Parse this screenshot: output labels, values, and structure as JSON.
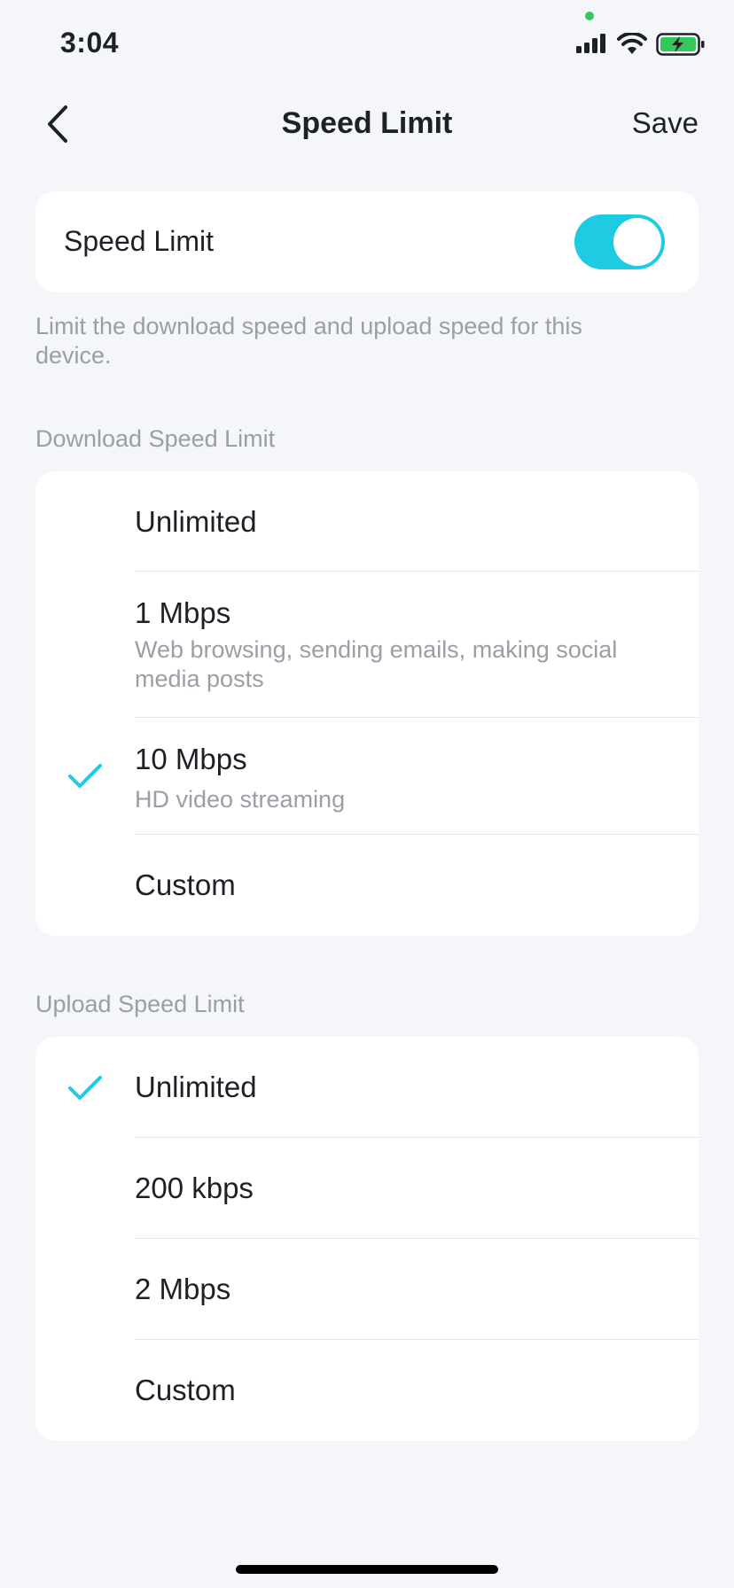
{
  "status_bar": {
    "time": "3:04"
  },
  "nav": {
    "title": "Speed Limit",
    "save_label": "Save"
  },
  "toggle": {
    "label": "Speed Limit",
    "on": true
  },
  "hint": "Limit the download speed and upload speed for this device.",
  "download": {
    "header": "Download Speed Limit",
    "options": [
      {
        "label": "Unlimited",
        "sub": "",
        "selected": false
      },
      {
        "label": "1 Mbps",
        "sub": "Web browsing, sending emails, making social media posts",
        "selected": false
      },
      {
        "label": "10 Mbps",
        "sub": "HD video streaming",
        "selected": true
      },
      {
        "label": "Custom",
        "sub": "",
        "selected": false
      }
    ]
  },
  "upload": {
    "header": "Upload Speed Limit",
    "options": [
      {
        "label": "Unlimited",
        "selected": true
      },
      {
        "label": "200 kbps",
        "selected": false
      },
      {
        "label": "2 Mbps",
        "selected": false
      },
      {
        "label": "Custom",
        "selected": false
      }
    ]
  },
  "colors": {
    "accent": "#1fcbe3",
    "background": "#f4f6fa",
    "muted": "#9a9ea6"
  },
  "icons": {
    "back": "chevron-left-icon",
    "check": "checkmark-icon"
  }
}
